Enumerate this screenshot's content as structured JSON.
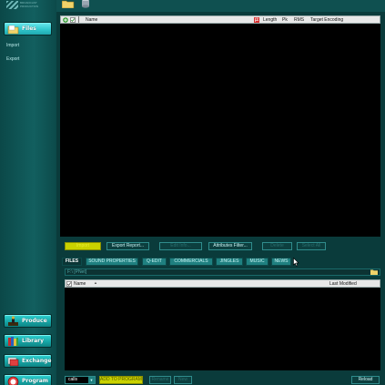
{
  "sidebar": {
    "logo_text": "BROADCAST PRODUCTION",
    "files_label": "Files",
    "links": [
      "Import",
      "Export"
    ],
    "bottom_tiles": [
      "Produce",
      "Library",
      "Exchange",
      "Program"
    ]
  },
  "upper_list": {
    "columns": [
      "Name",
      "Length",
      "Pk",
      "RMS",
      "Target Encoding"
    ]
  },
  "toolbar": {
    "buttons": [
      "Import",
      "Export Report...",
      "Edit Info...",
      "Attributes Filter...",
      "Delete",
      "Select All"
    ]
  },
  "tabs": [
    "FILES",
    "SOUND PROPERTIES",
    "Q-EDIT",
    "COMMERCIALS",
    "JINGLES",
    "MUSIC",
    "NEWS"
  ],
  "path_bar": {
    "text": "F:\\ [PNet]"
  },
  "lower_list": {
    "columns": [
      "Name",
      "Last Modified"
    ]
  },
  "bottom_bar": {
    "select_value": "calls",
    "buttons": [
      "ADD TO PROGRAM",
      "Rename",
      "New",
      "Reload"
    ]
  },
  "colors": {
    "accent": "#2fc6cc",
    "background": "#0a3b3b",
    "highlight": "#c9d200"
  }
}
